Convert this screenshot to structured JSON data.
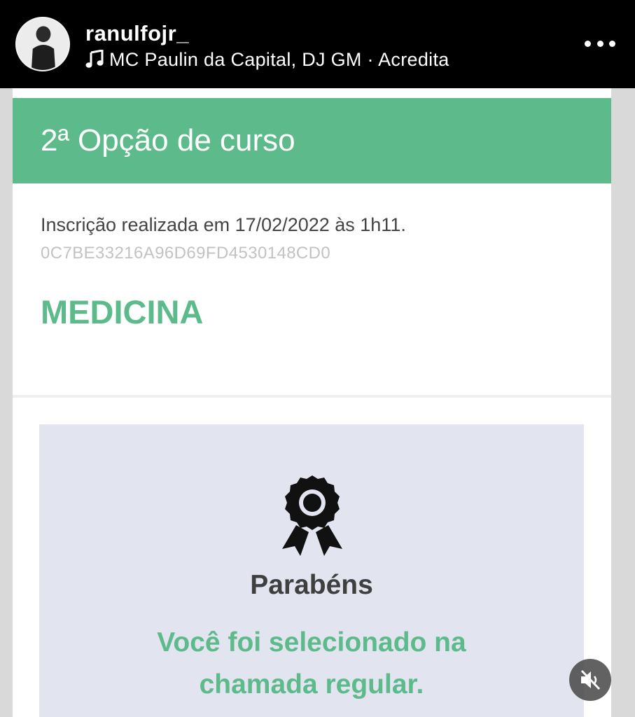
{
  "story": {
    "username": "ranulfojr_",
    "music": "MC Paulin da Capital, DJ GM · Acredita",
    "avatar_icon": "profile-avatar",
    "music_icon": "music-note-icon",
    "more_icon": "more-options-icon",
    "mute_icon": "speaker-muted-icon"
  },
  "card": {
    "header_title": "2ª Opção de curso",
    "inscricao": "Inscrição realizada em 17/02/2022 às 1h11.",
    "hash": "0C7BE33216A96D69FD4530148CD0",
    "course": "MEDICINA",
    "result": {
      "icon": "award-ribbon-icon",
      "congrats": "Parabéns",
      "message_line1": "Você foi selecionado na",
      "message_line2": "chamada regular."
    }
  },
  "colors": {
    "accent_green": "#5dba8b",
    "result_bg": "#e2e4ef",
    "story_bar": "#000000"
  }
}
